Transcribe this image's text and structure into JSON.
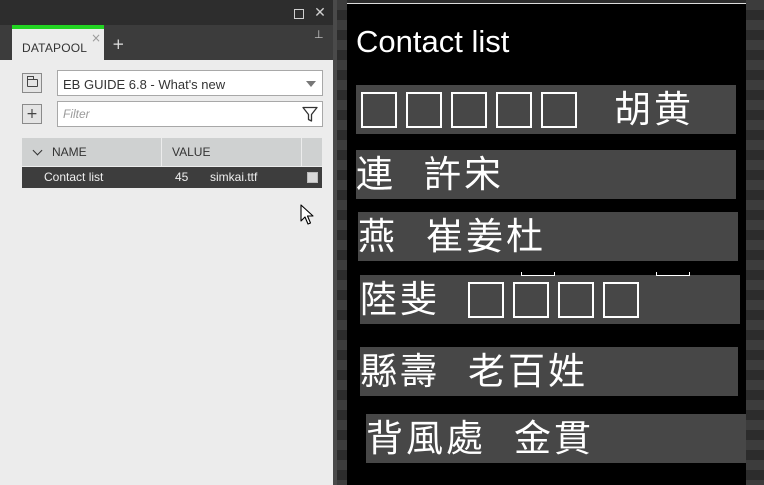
{
  "panel": {
    "tab_label": "DATAPOOL",
    "tab_close": "×",
    "tab_add": "+",
    "pin": "⊥",
    "close": "✕",
    "project": {
      "selected": "EB GUIDE 6.8 - What's new"
    },
    "filter": {
      "placeholder": "Filter",
      "value": ""
    },
    "table": {
      "columns": [
        "NAME",
        "VALUE"
      ],
      "rows": [
        {
          "name": "Contact list",
          "value_number": "45",
          "value_font": "simkai.ttf"
        }
      ]
    }
  },
  "scene": {
    "title": "Contact list",
    "entries": [
      {
        "chars": "胡黄"
      },
      {
        "left": "連",
        "right": "許宋"
      },
      {
        "left": "燕",
        "right": "崔姜杜"
      },
      {
        "left": "陸斐"
      },
      {
        "left": "縣壽",
        "right": "老百姓"
      },
      {
        "left": "背風處",
        "right": "金貫"
      }
    ]
  },
  "colors": {
    "tab_accent": "#22d422",
    "row_selected": "#3d3d3d",
    "entry_background": "#474747",
    "scene_background": "#000000"
  },
  "icons": [
    "maximize-icon",
    "close-icon",
    "pin-icon",
    "folder-icon",
    "add-icon",
    "filter-funnel-icon",
    "sort-chevron-icon",
    "mouse-cursor-icon"
  ]
}
